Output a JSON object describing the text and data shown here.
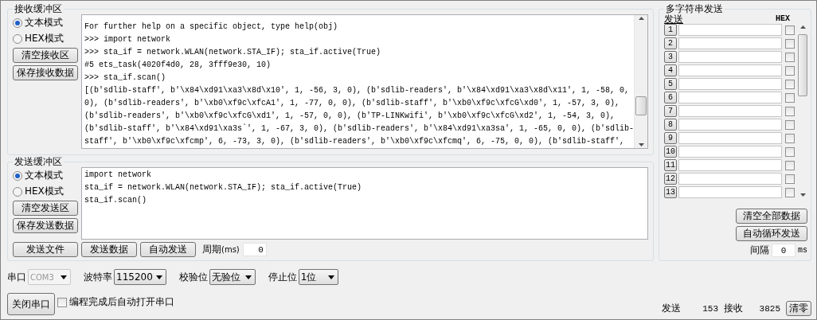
{
  "receive": {
    "title": "接收缓冲区",
    "modes": [
      {
        "label": "文本模式",
        "selected": true
      },
      {
        "label": "HEX模式",
        "selected": false
      }
    ],
    "buttons": [
      "清空接收区",
      "保存接收数据"
    ],
    "lines": [
      "For further help on a specific object, type help(obj)",
      ">>> import network",
      ">>> sta_if = network.WLAN(network.STA_IF); sta_if.active(True)",
      "#5 ets_task(4020f4d0, 28, 3fff9e30, 10)",
      ">>> sta_if.scan()",
      "[(b'sdlib-staff', b'\\x84\\xd91\\xa3\\x8d\\x10', 1, -56, 3, 0), (b'sdlib-readers', b'\\x84\\xd91\\xa3\\x8d\\x11', 1, -58, 0,",
      "0), (b'sdlib-readers', b'\\xb0\\xf9c\\xfcA1', 1, -77, 0, 0), (b'sdlib-staff', b'\\xb0\\xf9c\\xfcG\\xd0', 1, -57, 3, 0),",
      "(b'sdlib-readers', b'\\xb0\\xf9c\\xfcG\\xd1', 1, -57, 0, 0), (b'TP-LINKwifi', b'\\xb0\\xf9c\\xfcG\\xd2', 1, -54, 3, 0),",
      "(b'sdlib-staff', b'\\x84\\xd91\\xa3s`', 1, -67, 3, 0), (b'sdlib-readers', b'\\x84\\xd91\\xa3sa', 1, -65, 0, 0), (b'sdlib-",
      "staff', b'\\xb0\\xf9c\\xfcmp', 6, -73, 3, 0), (b'sdlib-readers', b'\\xb0\\xf9c\\xfcmq', 6, -75, 0, 0), (b'sdlib-staff',"
    ]
  },
  "send": {
    "title": "发送缓冲区",
    "modes": [
      {
        "label": "文本模式",
        "selected": true
      },
      {
        "label": "HEX模式",
        "selected": false
      }
    ],
    "buttons": [
      "清空发送区",
      "保存发送数据"
    ],
    "lines": [
      "import network",
      "sta_if = network.WLAN(network.STA_IF); sta_if.active(True)",
      "sta_if.scan()"
    ],
    "actions": [
      "发送文件",
      "发送数据",
      "自动发送"
    ],
    "period_label": "周期",
    "period_unit": "(ms)",
    "period_value": "0"
  },
  "multi": {
    "title": "多字符串发送",
    "send_header": "发送",
    "hex_header": "HEX",
    "rows": [
      {
        "button": "1",
        "hex": false
      },
      {
        "button": "2",
        "hex": false
      },
      {
        "button": "3",
        "hex": false
      },
      {
        "button": "4",
        "hex": false
      },
      {
        "button": "5",
        "hex": false
      },
      {
        "button": "6",
        "hex": false
      },
      {
        "button": "7",
        "hex": false
      },
      {
        "button": "8",
        "hex": false
      },
      {
        "button": "9",
        "hex": false
      },
      {
        "button": "10",
        "hex": false
      },
      {
        "button": "11",
        "hex": false
      },
      {
        "button": "12",
        "hex": false
      },
      {
        "button": "13",
        "hex": false
      }
    ],
    "buttons": [
      "清空全部数据",
      "自动循环发送"
    ],
    "interval_label": "间隔",
    "interval_value": "0",
    "interval_unit": "ms"
  },
  "serial": [
    {
      "label": "串口",
      "value": "COM3",
      "disabled": true
    },
    {
      "label": "波特率",
      "value": "115200",
      "disabled": false
    },
    {
      "label": "校验位",
      "value": "无验位",
      "disabled": false
    },
    {
      "label": "停止位",
      "value": "1位",
      "disabled": false
    }
  ],
  "close_button": "关闭串口",
  "auto_open": {
    "label": "编程完成后自动打开串口",
    "checked": false
  },
  "counters": [
    {
      "label": "发送",
      "value": "153"
    },
    {
      "label": "接收",
      "value": "3825"
    }
  ],
  "clear_button": "清零"
}
